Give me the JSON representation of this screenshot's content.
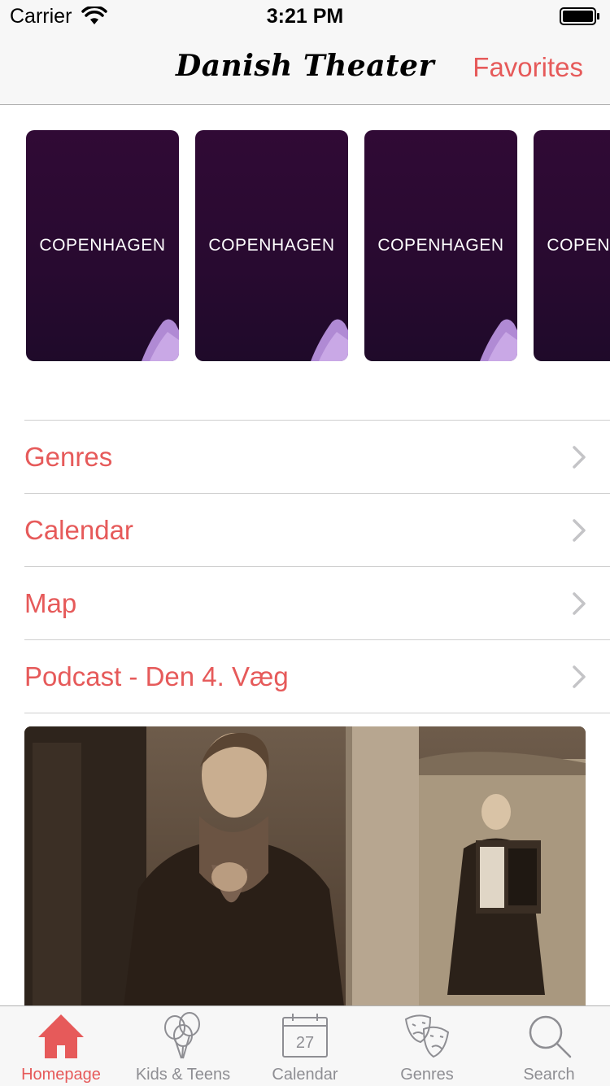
{
  "status": {
    "carrier": "Carrier",
    "time": "3:21 PM"
  },
  "nav": {
    "title": "Danish Theater",
    "favorites_label": "Favorites"
  },
  "carousel": {
    "cards": [
      {
        "label": "COPENHAGEN"
      },
      {
        "label": "COPENHAGEN"
      },
      {
        "label": "COPENHAGEN"
      },
      {
        "label": "COPENHAGEN"
      }
    ]
  },
  "menu": {
    "items": [
      {
        "label": "Genres"
      },
      {
        "label": "Calendar"
      },
      {
        "label": "Map"
      },
      {
        "label": "Podcast - Den 4. Væg"
      }
    ]
  },
  "tabs": [
    {
      "label": "Homepage",
      "icon": "home-icon",
      "active": true
    },
    {
      "label": "Kids & Teens",
      "icon": "balloons-icon",
      "active": false
    },
    {
      "label": "Calendar",
      "icon": "calendar-icon",
      "active": false,
      "calendar_day": "27"
    },
    {
      "label": "Genres",
      "icon": "theater-masks-icon",
      "active": false
    },
    {
      "label": "Search",
      "icon": "search-icon",
      "active": false
    }
  ],
  "colors": {
    "accent": "#e65a5a",
    "card_bg": "#2a0a30",
    "inactive": "#8e8e93"
  }
}
